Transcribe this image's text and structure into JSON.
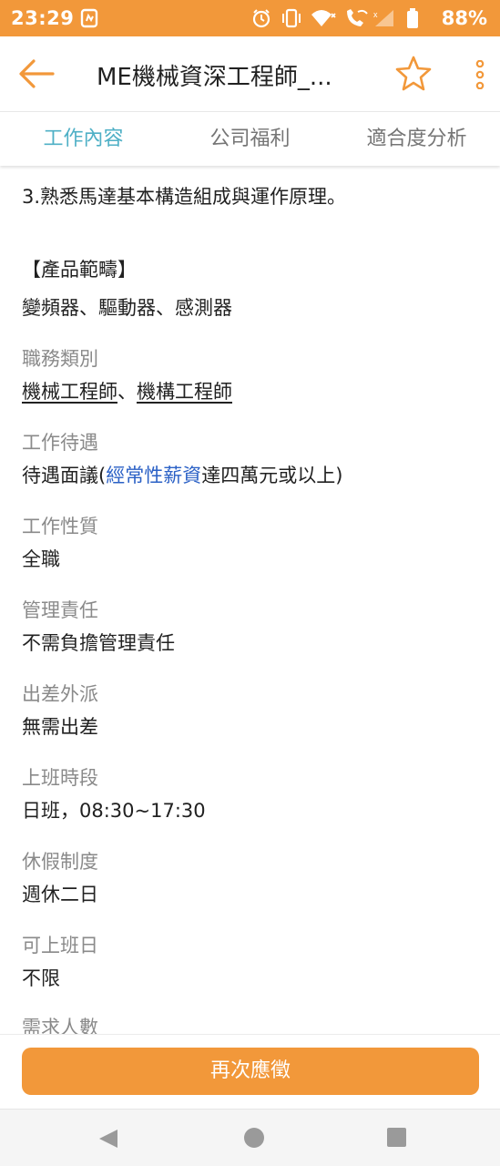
{
  "status_bar": {
    "time": "23:29",
    "battery": "88%",
    "icons": [
      "app-notification-icon",
      "alarm-icon",
      "vibrate-icon",
      "wifi-icon",
      "wifi-calling-icon",
      "signal-icon",
      "battery-icon"
    ]
  },
  "app_bar": {
    "title": "ME機械資深工程師_...",
    "icons": [
      "back-arrow-icon",
      "star-outline-icon",
      "more-vert-icon"
    ]
  },
  "tabs": [
    {
      "label": "工作內容",
      "active": true
    },
    {
      "label": "公司福利",
      "active": false
    },
    {
      "label": "適合度分析",
      "active": false
    }
  ],
  "content": {
    "requirement_line": "3.熟悉馬達基本構造組成與運作原理。",
    "product_heading": "【產品範疇】",
    "product_text": "變頻器、驅動器、感測器",
    "job_category": {
      "label": "職務類別",
      "item1": "機械工程師",
      "separator": "、",
      "item2": "機構工程師"
    },
    "salary": {
      "label": "工作待遇",
      "prefix": "待遇面議(",
      "link": "經常性薪資",
      "suffix": "達四萬元或以上)"
    },
    "fields": [
      {
        "label": "工作性質",
        "value": "全職"
      },
      {
        "label": "管理責任",
        "value": "不需負擔管理責任"
      },
      {
        "label": "出差外派",
        "value": "無需出差"
      },
      {
        "label": "上班時段",
        "value": "日班，08:30~17:30"
      },
      {
        "label": "休假制度",
        "value": "週休二日"
      },
      {
        "label": "可上班日",
        "value": "不限"
      }
    ],
    "partial_label": "需求人數"
  },
  "apply_button": {
    "label": "再次應徵"
  },
  "colors": {
    "accent": "#f2983a",
    "tab_active": "#4fb0c6",
    "link": "#2b61c6",
    "label_gray": "#8a8a8a"
  }
}
